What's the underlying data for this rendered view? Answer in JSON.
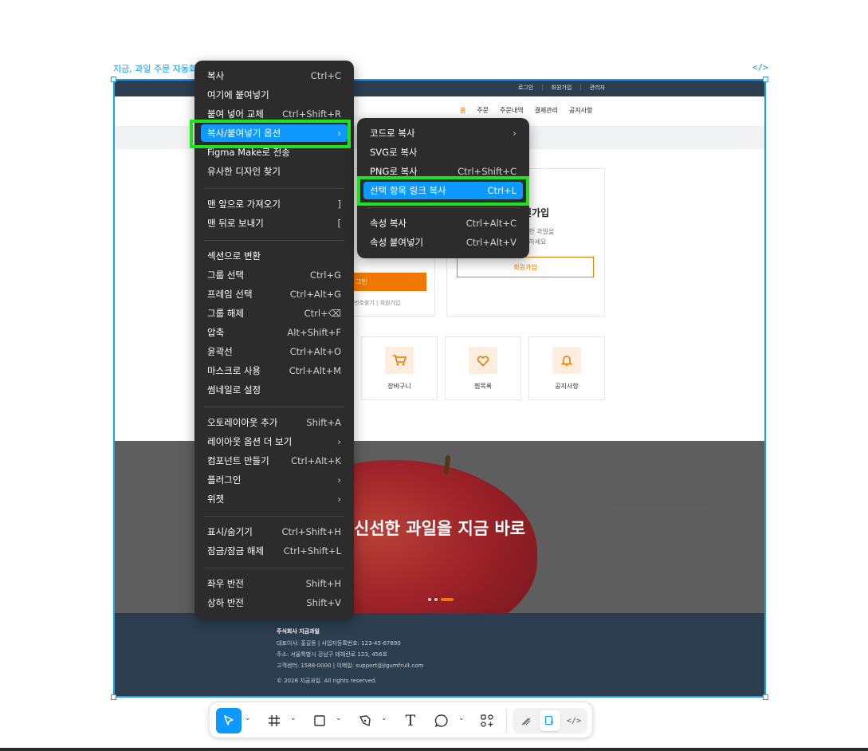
{
  "frame": {
    "label": "지금, 과일 주문 자동화",
    "code_icon": "</>"
  },
  "site": {
    "topbar_links": [
      "로그인",
      "회원가입",
      "관리자"
    ],
    "nav": [
      "홈",
      "주문",
      "주문내역",
      "결제관리",
      "공지사항"
    ],
    "signup": {
      "title": "원가입",
      "desc_line1": "선한 과일을",
      "desc_line2": "문하세요",
      "button": "회원가입"
    },
    "login": {
      "button": "그인",
      "links": "번호찾기  |  회원가입"
    },
    "quick": [
      {
        "label": "장바구니",
        "icon": "cart-icon"
      },
      {
        "label": "찜목록",
        "icon": "heart-icon"
      },
      {
        "label": "공지사항",
        "icon": "bell-icon"
      }
    ],
    "hero_text": "신선한 과일을 지금 바로",
    "footer": {
      "company": "주식회사 지금과일",
      "line1": "대표이사: 홍길동 | 사업자등록번호: 123-45-67890",
      "line2": "주소: 서울특별시 강남구 테헤란로 123, 456호",
      "line3": "고객센터: 1588-0000 | 이메일: support@jigumfruit.com",
      "copyright": "© 2026 지금과일. All rights reserved."
    }
  },
  "context_menu": {
    "items": [
      {
        "label": "복사",
        "shortcut": "Ctrl+C"
      },
      {
        "label": "여기에 붙여넣기",
        "shortcut": ""
      },
      {
        "label": "붙여 넣어 교체",
        "shortcut": "Ctrl+Shift+R"
      },
      {
        "label": "복사/붙여넣기 옵션",
        "shortcut": "›"
      },
      {
        "label": "Figma Make로 전송",
        "shortcut": ""
      },
      {
        "label": "유사한 디자인 찾기",
        "shortcut": ""
      },
      {
        "label": "맨 앞으로 가져오기",
        "shortcut": "]"
      },
      {
        "label": "맨 뒤로 보내기",
        "shortcut": "["
      },
      {
        "label": "섹션으로 변환",
        "shortcut": ""
      },
      {
        "label": "그룹 선택",
        "shortcut": "Ctrl+G"
      },
      {
        "label": "프레임 선택",
        "shortcut": "Ctrl+Alt+G"
      },
      {
        "label": "그룹 해제",
        "shortcut": "Ctrl+⌫"
      },
      {
        "label": "압축",
        "shortcut": "Alt+Shift+F"
      },
      {
        "label": "윤곽선",
        "shortcut": "Ctrl+Alt+O"
      },
      {
        "label": "마스크로 사용",
        "shortcut": "Ctrl+Alt+M"
      },
      {
        "label": "썸네일로 설정",
        "shortcut": ""
      },
      {
        "label": "오토레이아웃 추가",
        "shortcut": "Shift+A"
      },
      {
        "label": "레이아웃 옵션 더 보기",
        "shortcut": "›"
      },
      {
        "label": "컴포넌트 만들기",
        "shortcut": "Ctrl+Alt+K"
      },
      {
        "label": "플러그인",
        "shortcut": "›"
      },
      {
        "label": "위젯",
        "shortcut": "›"
      },
      {
        "label": "표시/숨기기",
        "shortcut": "Ctrl+Shift+H"
      },
      {
        "label": "잠금/잠금 해제",
        "shortcut": "Ctrl+Shift+L"
      },
      {
        "label": "좌우 반전",
        "shortcut": "Shift+H"
      },
      {
        "label": "상하 반전",
        "shortcut": "Shift+V"
      }
    ]
  },
  "submenu": {
    "items": [
      {
        "label": "코드로 복사",
        "shortcut": "›"
      },
      {
        "label": "SVG로 복사",
        "shortcut": ""
      },
      {
        "label": "PNG로 복사",
        "shortcut": "Ctrl+Shift+C"
      },
      {
        "label": "선택 항목 링크 복사",
        "shortcut": "Ctrl+L"
      },
      {
        "label": "속성 복사",
        "shortcut": "Ctrl+Alt+C"
      },
      {
        "label": "속성 붙여넣기",
        "shortcut": "Ctrl+Alt+V"
      }
    ]
  },
  "toolbar": {
    "tools": [
      "move-icon",
      "frame-icon",
      "rectangle-icon",
      "pen-icon",
      "text-icon",
      "comment-icon",
      "actions-icon"
    ],
    "text_tool": "T",
    "mode_code": "</>"
  },
  "colors": {
    "accent": "#0d99ff",
    "highlight": "#1ee21a",
    "brand_orange": "#f07800",
    "menu_bg": "#2c2c2c",
    "navy": "#2c3e50"
  }
}
